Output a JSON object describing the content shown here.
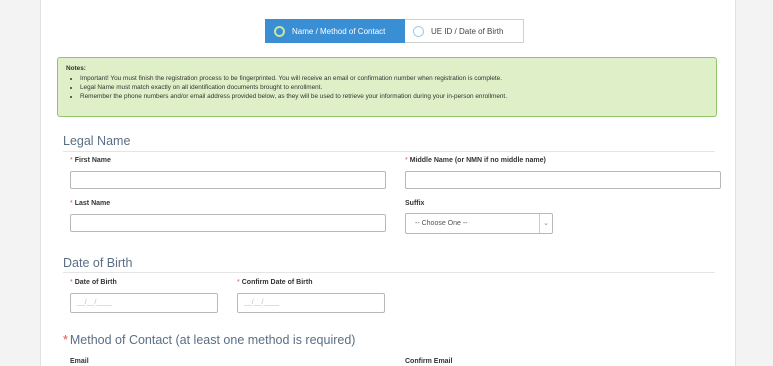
{
  "tabs": [
    {
      "label": "Name / Method of Contact",
      "active": true
    },
    {
      "label": "UE ID / Date of Birth",
      "active": false
    }
  ],
  "notes": {
    "title": "Notes:",
    "items": [
      "Important! You must finish the registration process to be fingerprinted. You will receive an email or confirmation number when registration is complete.",
      "Legal Name must match exactly on all identification documents brought to enrollment.",
      "Remember the phone numbers and/or email address provided below, as they will be used to retrieve your information during your in-person enrollment."
    ]
  },
  "legal_name": {
    "title": "Legal Name",
    "first_name_label": "First Name",
    "middle_name_label": "Middle Name (or NMN if no middle name)",
    "last_name_label": "Last Name",
    "suffix_label": "Suffix",
    "suffix_selected": "-- Choose One --"
  },
  "date_of_birth": {
    "title": "Date of Birth",
    "dob_label": "Date of Birth",
    "confirm_dob_label": "Confirm Date of Birth",
    "dob_placeholder": "__/__/____",
    "confirm_dob_placeholder": "__/__/____"
  },
  "method_of_contact": {
    "title": "Method of Contact (at least one method is required)",
    "email_label": "Email",
    "confirm_email_label": "Confirm Email"
  },
  "colors": {
    "accent": "#3a8fd4",
    "notes_bg": "#dff0c8",
    "required": "#d9534f",
    "section_title": "#5a6f85"
  },
  "icons": {
    "radio_active": "radio-selected-icon",
    "radio_inactive": "radio-unselected-icon",
    "select_arrow": "chevron-down-icon"
  }
}
